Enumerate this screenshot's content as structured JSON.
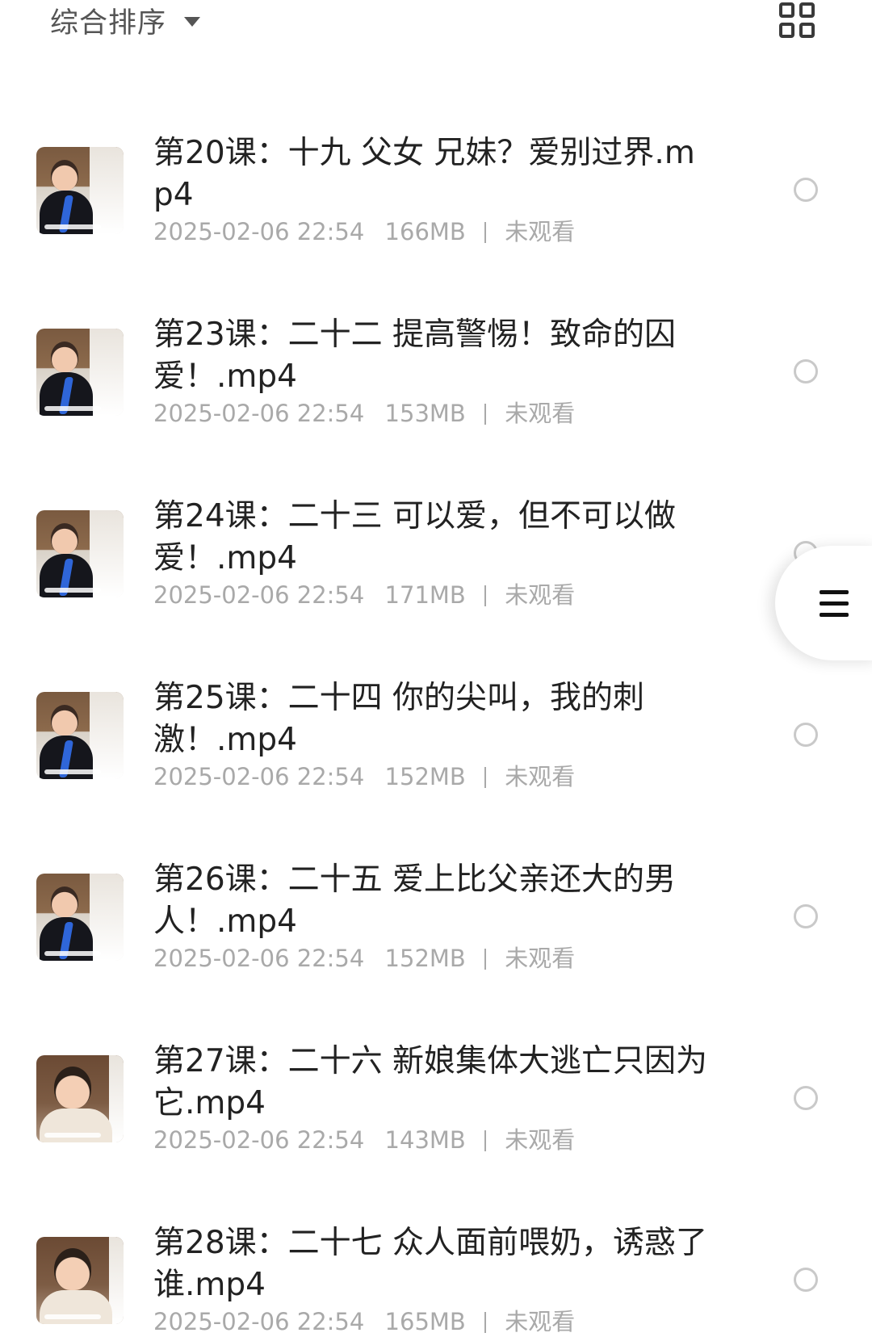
{
  "toolbar": {
    "sort_label": "综合排序",
    "sort_icon": "caret-down-icon",
    "view_icon": "grid-view-icon"
  },
  "floating_button": {
    "icon": "menu-icon"
  },
  "files": [
    {
      "title": "第20课：十九 父女 兄妹？爱别过界.mp4",
      "date": "2025-02-06 22:54",
      "size": "166MB",
      "status": "未观看"
    },
    {
      "title": "第23课：二十二 提高警惕！致命的囚爱！.mp4",
      "date": "2025-02-06 22:54",
      "size": "153MB",
      "status": "未观看"
    },
    {
      "title": "第24课：二十三 可以爱，但不可以做爱！.mp4",
      "date": "2025-02-06 22:54",
      "size": "171MB",
      "status": "未观看"
    },
    {
      "title": "第25课：二十四 你的尖叫，我的刺激！.mp4",
      "date": "2025-02-06 22:54",
      "size": "152MB",
      "status": "未观看"
    },
    {
      "title": "第26课：二十五 爱上比父亲还大的男人！.mp4",
      "date": "2025-02-06 22:54",
      "size": "152MB",
      "status": "未观看"
    },
    {
      "title": "第27课：二十六 新娘集体大逃亡只因为它.mp4",
      "date": "2025-02-06 22:54",
      "size": "143MB",
      "status": "未观看"
    },
    {
      "title": "第28课：二十七 众人面前喂奶，诱惑了谁.mp4",
      "date": "2025-02-06 22:54",
      "size": "165MB",
      "status": "未观看"
    }
  ]
}
